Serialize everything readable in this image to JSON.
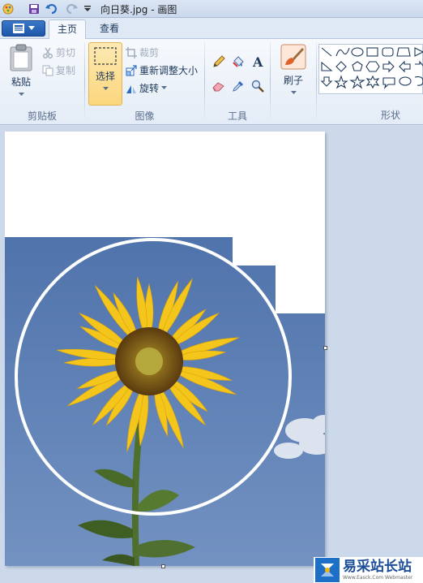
{
  "window": {
    "title": "向日葵.jpg - 画图"
  },
  "quick_access": {
    "icons": [
      "paint-app-icon",
      "save-icon",
      "undo-icon",
      "redo-icon",
      "customize-dropdown-icon"
    ]
  },
  "tabs": [
    {
      "label": "主页",
      "active": true
    },
    {
      "label": "查看",
      "active": false
    }
  ],
  "ribbon": {
    "clipboard": {
      "label": "剪贴板",
      "paste": "粘贴",
      "cut": "剪切",
      "copy": "复制"
    },
    "image": {
      "label": "图像",
      "select": "选择",
      "crop": "裁剪",
      "resize": "重新调整大小",
      "rotate": "旋转"
    },
    "tools": {
      "label": "工具"
    },
    "brush": {
      "label": "刷子"
    },
    "shapes": {
      "label": "形状"
    }
  },
  "watermark": {
    "main": "易采站长站",
    "sub": "Www.Easck.Com Webmaster"
  },
  "colors": {
    "accent": "#1d56a8",
    "sky": "#5b7eb4",
    "select_highlight": "#fbd77d"
  }
}
